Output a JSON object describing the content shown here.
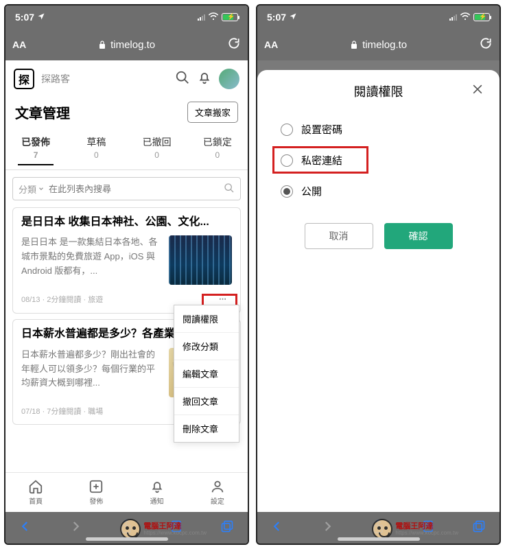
{
  "status": {
    "time": "5:07",
    "loc_icon": "location-arrow",
    "battery_pct": 70
  },
  "address": {
    "domain": "timelog.to"
  },
  "left": {
    "brand": "探路客",
    "header_title": "文章管理",
    "move_btn": "文章搬家",
    "tabs": [
      {
        "label": "已發佈",
        "count": "7",
        "active": true
      },
      {
        "label": "草稿",
        "count": "0"
      },
      {
        "label": "已撤回",
        "count": "0"
      },
      {
        "label": "已鎖定",
        "count": "0"
      }
    ],
    "search": {
      "category_label": "分類",
      "placeholder": "在此列表內搜尋"
    },
    "articles": [
      {
        "title": "是日日本 收集日本神社、公園、文化...",
        "excerpt": "是日日本 是一款集結日本各地、各城市景點的免費旅遊 App，iOS 與 Android 版都有，...",
        "meta": "08/13 · 2分鐘閱讀 · 旅遊"
      },
      {
        "title": "日本薪水普遍都是多少？各產業...",
        "excerpt": "日本薪水普遍都多少？剛出社會的年輕人可以領多少？每個行業的平均薪資大概到哪裡...",
        "meta": "07/18 · 7分鐘閱讀 · 職場"
      }
    ],
    "dropdown": [
      "閱讀權限",
      "修改分類",
      "編輯文章",
      "撤回文章",
      "刪除文章"
    ],
    "bottom_nav": [
      {
        "label": "首頁"
      },
      {
        "label": "發佈"
      },
      {
        "label": "通知"
      },
      {
        "label": "設定"
      }
    ]
  },
  "right": {
    "modal_title": "閱讀權限",
    "options": [
      {
        "label": "設置密碼",
        "selected": false
      },
      {
        "label": "私密連結",
        "selected": false,
        "highlighted": true
      },
      {
        "label": "公開",
        "selected": true
      }
    ],
    "cancel": "取消",
    "confirm": "確認"
  },
  "watermark": {
    "name": "電腦王阿達",
    "url": "https://www.kocpc.com.tw"
  }
}
